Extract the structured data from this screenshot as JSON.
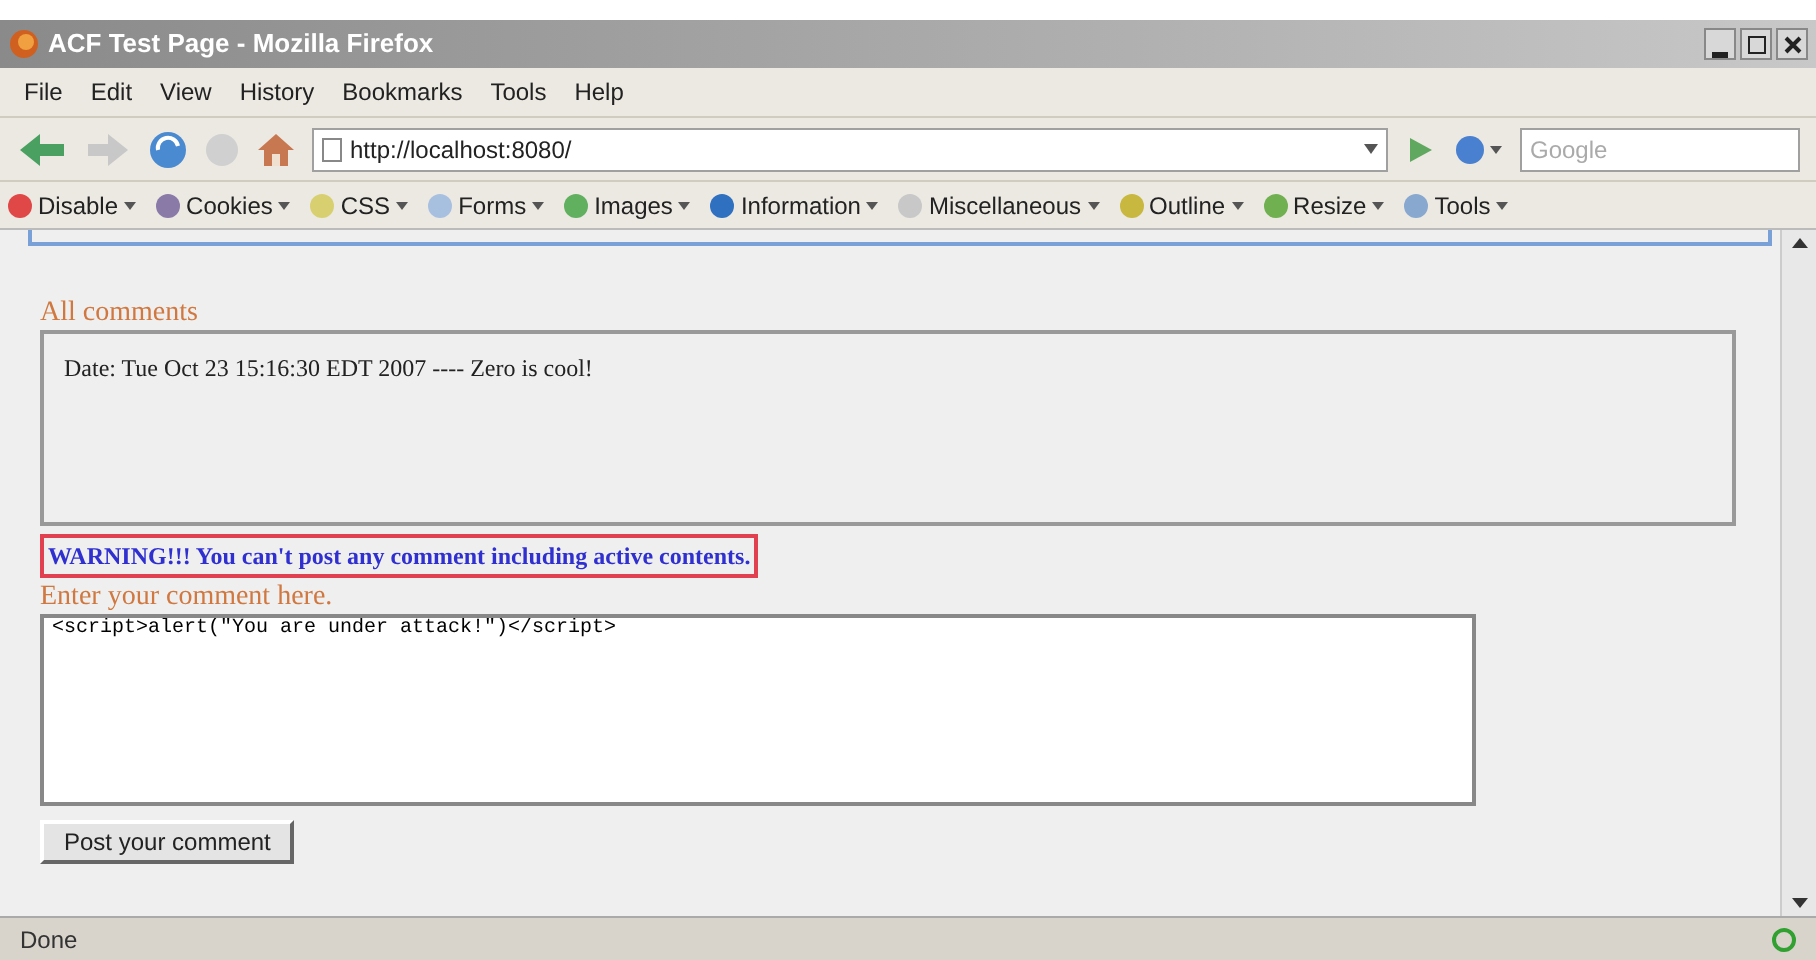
{
  "window": {
    "title": "ACF Test Page - Mozilla Firefox"
  },
  "menu": [
    "File",
    "Edit",
    "View",
    "History",
    "Bookmarks",
    "Tools",
    "Help"
  ],
  "address": {
    "value": "http://localhost:8080/"
  },
  "search": {
    "placeholder": "Google"
  },
  "dev_toolbar": [
    {
      "label": "Disable",
      "color": "#e04848"
    },
    {
      "label": "Cookies",
      "color": "#8a7aa8"
    },
    {
      "label": "CSS",
      "color": "#d8d070"
    },
    {
      "label": "Forms",
      "color": "#a8c0e0"
    },
    {
      "label": "Images",
      "color": "#60b060"
    },
    {
      "label": "Information",
      "color": "#3070c0"
    },
    {
      "label": "Miscellaneous",
      "color": "#c8c8c8"
    },
    {
      "label": "Outline",
      "color": "#c8b840"
    },
    {
      "label": "Resize",
      "color": "#70b050"
    },
    {
      "label": "Tools",
      "color": "#88a8d0"
    }
  ],
  "page": {
    "comments_heading": "All comments",
    "comments": [
      "Date: Tue Oct 23 15:16:30 EDT 2007 ---- Zero is cool!"
    ],
    "warning": "WARNING!!! You can't post any comment including active contents.",
    "comment_label": "Enter your comment here.",
    "comment_value": "<script>alert(\"You are under attack!\")</script>",
    "submit": "Post your comment"
  },
  "status_bar": {
    "text": "Done"
  }
}
